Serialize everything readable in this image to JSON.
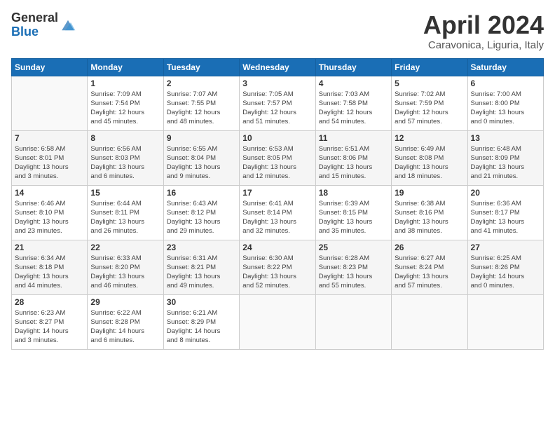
{
  "header": {
    "logo_general": "General",
    "logo_blue": "Blue",
    "month_title": "April 2024",
    "location": "Caravonica, Liguria, Italy"
  },
  "weekdays": [
    "Sunday",
    "Monday",
    "Tuesday",
    "Wednesday",
    "Thursday",
    "Friday",
    "Saturday"
  ],
  "weeks": [
    [
      {
        "day": "",
        "info": ""
      },
      {
        "day": "1",
        "info": "Sunrise: 7:09 AM\nSunset: 7:54 PM\nDaylight: 12 hours\nand 45 minutes."
      },
      {
        "day": "2",
        "info": "Sunrise: 7:07 AM\nSunset: 7:55 PM\nDaylight: 12 hours\nand 48 minutes."
      },
      {
        "day": "3",
        "info": "Sunrise: 7:05 AM\nSunset: 7:57 PM\nDaylight: 12 hours\nand 51 minutes."
      },
      {
        "day": "4",
        "info": "Sunrise: 7:03 AM\nSunset: 7:58 PM\nDaylight: 12 hours\nand 54 minutes."
      },
      {
        "day": "5",
        "info": "Sunrise: 7:02 AM\nSunset: 7:59 PM\nDaylight: 12 hours\nand 57 minutes."
      },
      {
        "day": "6",
        "info": "Sunrise: 7:00 AM\nSunset: 8:00 PM\nDaylight: 13 hours\nand 0 minutes."
      }
    ],
    [
      {
        "day": "7",
        "info": "Sunrise: 6:58 AM\nSunset: 8:01 PM\nDaylight: 13 hours\nand 3 minutes."
      },
      {
        "day": "8",
        "info": "Sunrise: 6:56 AM\nSunset: 8:03 PM\nDaylight: 13 hours\nand 6 minutes."
      },
      {
        "day": "9",
        "info": "Sunrise: 6:55 AM\nSunset: 8:04 PM\nDaylight: 13 hours\nand 9 minutes."
      },
      {
        "day": "10",
        "info": "Sunrise: 6:53 AM\nSunset: 8:05 PM\nDaylight: 13 hours\nand 12 minutes."
      },
      {
        "day": "11",
        "info": "Sunrise: 6:51 AM\nSunset: 8:06 PM\nDaylight: 13 hours\nand 15 minutes."
      },
      {
        "day": "12",
        "info": "Sunrise: 6:49 AM\nSunset: 8:08 PM\nDaylight: 13 hours\nand 18 minutes."
      },
      {
        "day": "13",
        "info": "Sunrise: 6:48 AM\nSunset: 8:09 PM\nDaylight: 13 hours\nand 21 minutes."
      }
    ],
    [
      {
        "day": "14",
        "info": "Sunrise: 6:46 AM\nSunset: 8:10 PM\nDaylight: 13 hours\nand 23 minutes."
      },
      {
        "day": "15",
        "info": "Sunrise: 6:44 AM\nSunset: 8:11 PM\nDaylight: 13 hours\nand 26 minutes."
      },
      {
        "day": "16",
        "info": "Sunrise: 6:43 AM\nSunset: 8:12 PM\nDaylight: 13 hours\nand 29 minutes."
      },
      {
        "day": "17",
        "info": "Sunrise: 6:41 AM\nSunset: 8:14 PM\nDaylight: 13 hours\nand 32 minutes."
      },
      {
        "day": "18",
        "info": "Sunrise: 6:39 AM\nSunset: 8:15 PM\nDaylight: 13 hours\nand 35 minutes."
      },
      {
        "day": "19",
        "info": "Sunrise: 6:38 AM\nSunset: 8:16 PM\nDaylight: 13 hours\nand 38 minutes."
      },
      {
        "day": "20",
        "info": "Sunrise: 6:36 AM\nSunset: 8:17 PM\nDaylight: 13 hours\nand 41 minutes."
      }
    ],
    [
      {
        "day": "21",
        "info": "Sunrise: 6:34 AM\nSunset: 8:18 PM\nDaylight: 13 hours\nand 44 minutes."
      },
      {
        "day": "22",
        "info": "Sunrise: 6:33 AM\nSunset: 8:20 PM\nDaylight: 13 hours\nand 46 minutes."
      },
      {
        "day": "23",
        "info": "Sunrise: 6:31 AM\nSunset: 8:21 PM\nDaylight: 13 hours\nand 49 minutes."
      },
      {
        "day": "24",
        "info": "Sunrise: 6:30 AM\nSunset: 8:22 PM\nDaylight: 13 hours\nand 52 minutes."
      },
      {
        "day": "25",
        "info": "Sunrise: 6:28 AM\nSunset: 8:23 PM\nDaylight: 13 hours\nand 55 minutes."
      },
      {
        "day": "26",
        "info": "Sunrise: 6:27 AM\nSunset: 8:24 PM\nDaylight: 13 hours\nand 57 minutes."
      },
      {
        "day": "27",
        "info": "Sunrise: 6:25 AM\nSunset: 8:26 PM\nDaylight: 14 hours\nand 0 minutes."
      }
    ],
    [
      {
        "day": "28",
        "info": "Sunrise: 6:23 AM\nSunset: 8:27 PM\nDaylight: 14 hours\nand 3 minutes."
      },
      {
        "day": "29",
        "info": "Sunrise: 6:22 AM\nSunset: 8:28 PM\nDaylight: 14 hours\nand 6 minutes."
      },
      {
        "day": "30",
        "info": "Sunrise: 6:21 AM\nSunset: 8:29 PM\nDaylight: 14 hours\nand 8 minutes."
      },
      {
        "day": "",
        "info": ""
      },
      {
        "day": "",
        "info": ""
      },
      {
        "day": "",
        "info": ""
      },
      {
        "day": "",
        "info": ""
      }
    ]
  ]
}
